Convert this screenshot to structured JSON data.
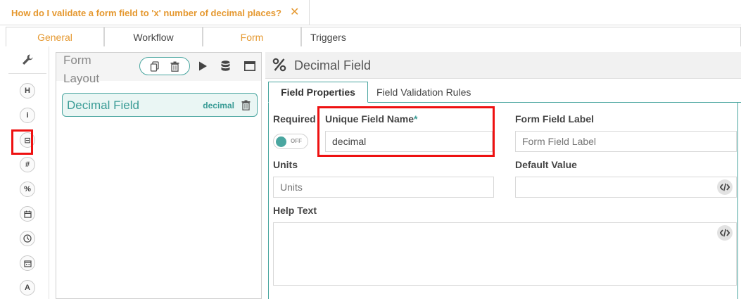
{
  "title_tab": {
    "title": "How do I validate a form field to 'x' number of decimal places?",
    "close_glyph": "✕"
  },
  "tabs": [
    {
      "label": "General",
      "state": "inactive-accent"
    },
    {
      "label": "Workflow",
      "state": "inactive"
    },
    {
      "label": "Form",
      "state": "active"
    },
    {
      "label": "Triggers",
      "state": "inactive"
    }
  ],
  "icon_strip": [
    {
      "name": "wrench-icon",
      "glyph": ""
    },
    {
      "name": "heading-icon",
      "glyph": "H"
    },
    {
      "name": "info-icon",
      "glyph": "i"
    },
    {
      "name": "minus-box-icon",
      "glyph": "⊟"
    },
    {
      "name": "hash-icon",
      "glyph": "#"
    },
    {
      "name": "percent-icon",
      "glyph": "%"
    },
    {
      "name": "calendar-icon",
      "glyph": ""
    },
    {
      "name": "clock-icon",
      "glyph": ""
    },
    {
      "name": "calendar-grid-icon",
      "glyph": ""
    },
    {
      "name": "text-a-icon",
      "glyph": "A"
    }
  ],
  "layout": {
    "title": "Form Layout",
    "field_item": {
      "label": "Decimal Field",
      "type": "decimal"
    }
  },
  "field_panel": {
    "title": "Decimal Field",
    "subtabs": [
      "Field Properties",
      "Field Validation Rules"
    ],
    "required_label": "Required",
    "toggle_text": "OFF",
    "toggle_on": false,
    "unique_name_label": "Unique Field Name",
    "required_marker": "*",
    "unique_name_value": "decimal",
    "form_label_label": "Form Field Label",
    "form_label_placeholder": "Form Field Label",
    "units_label": "Units",
    "units_placeholder": "Units",
    "default_label": "Default Value",
    "help_label": "Help Text"
  },
  "colors": {
    "accent": "#e5982f",
    "teal": "#4aa6a0",
    "highlight": "#ee1111"
  }
}
